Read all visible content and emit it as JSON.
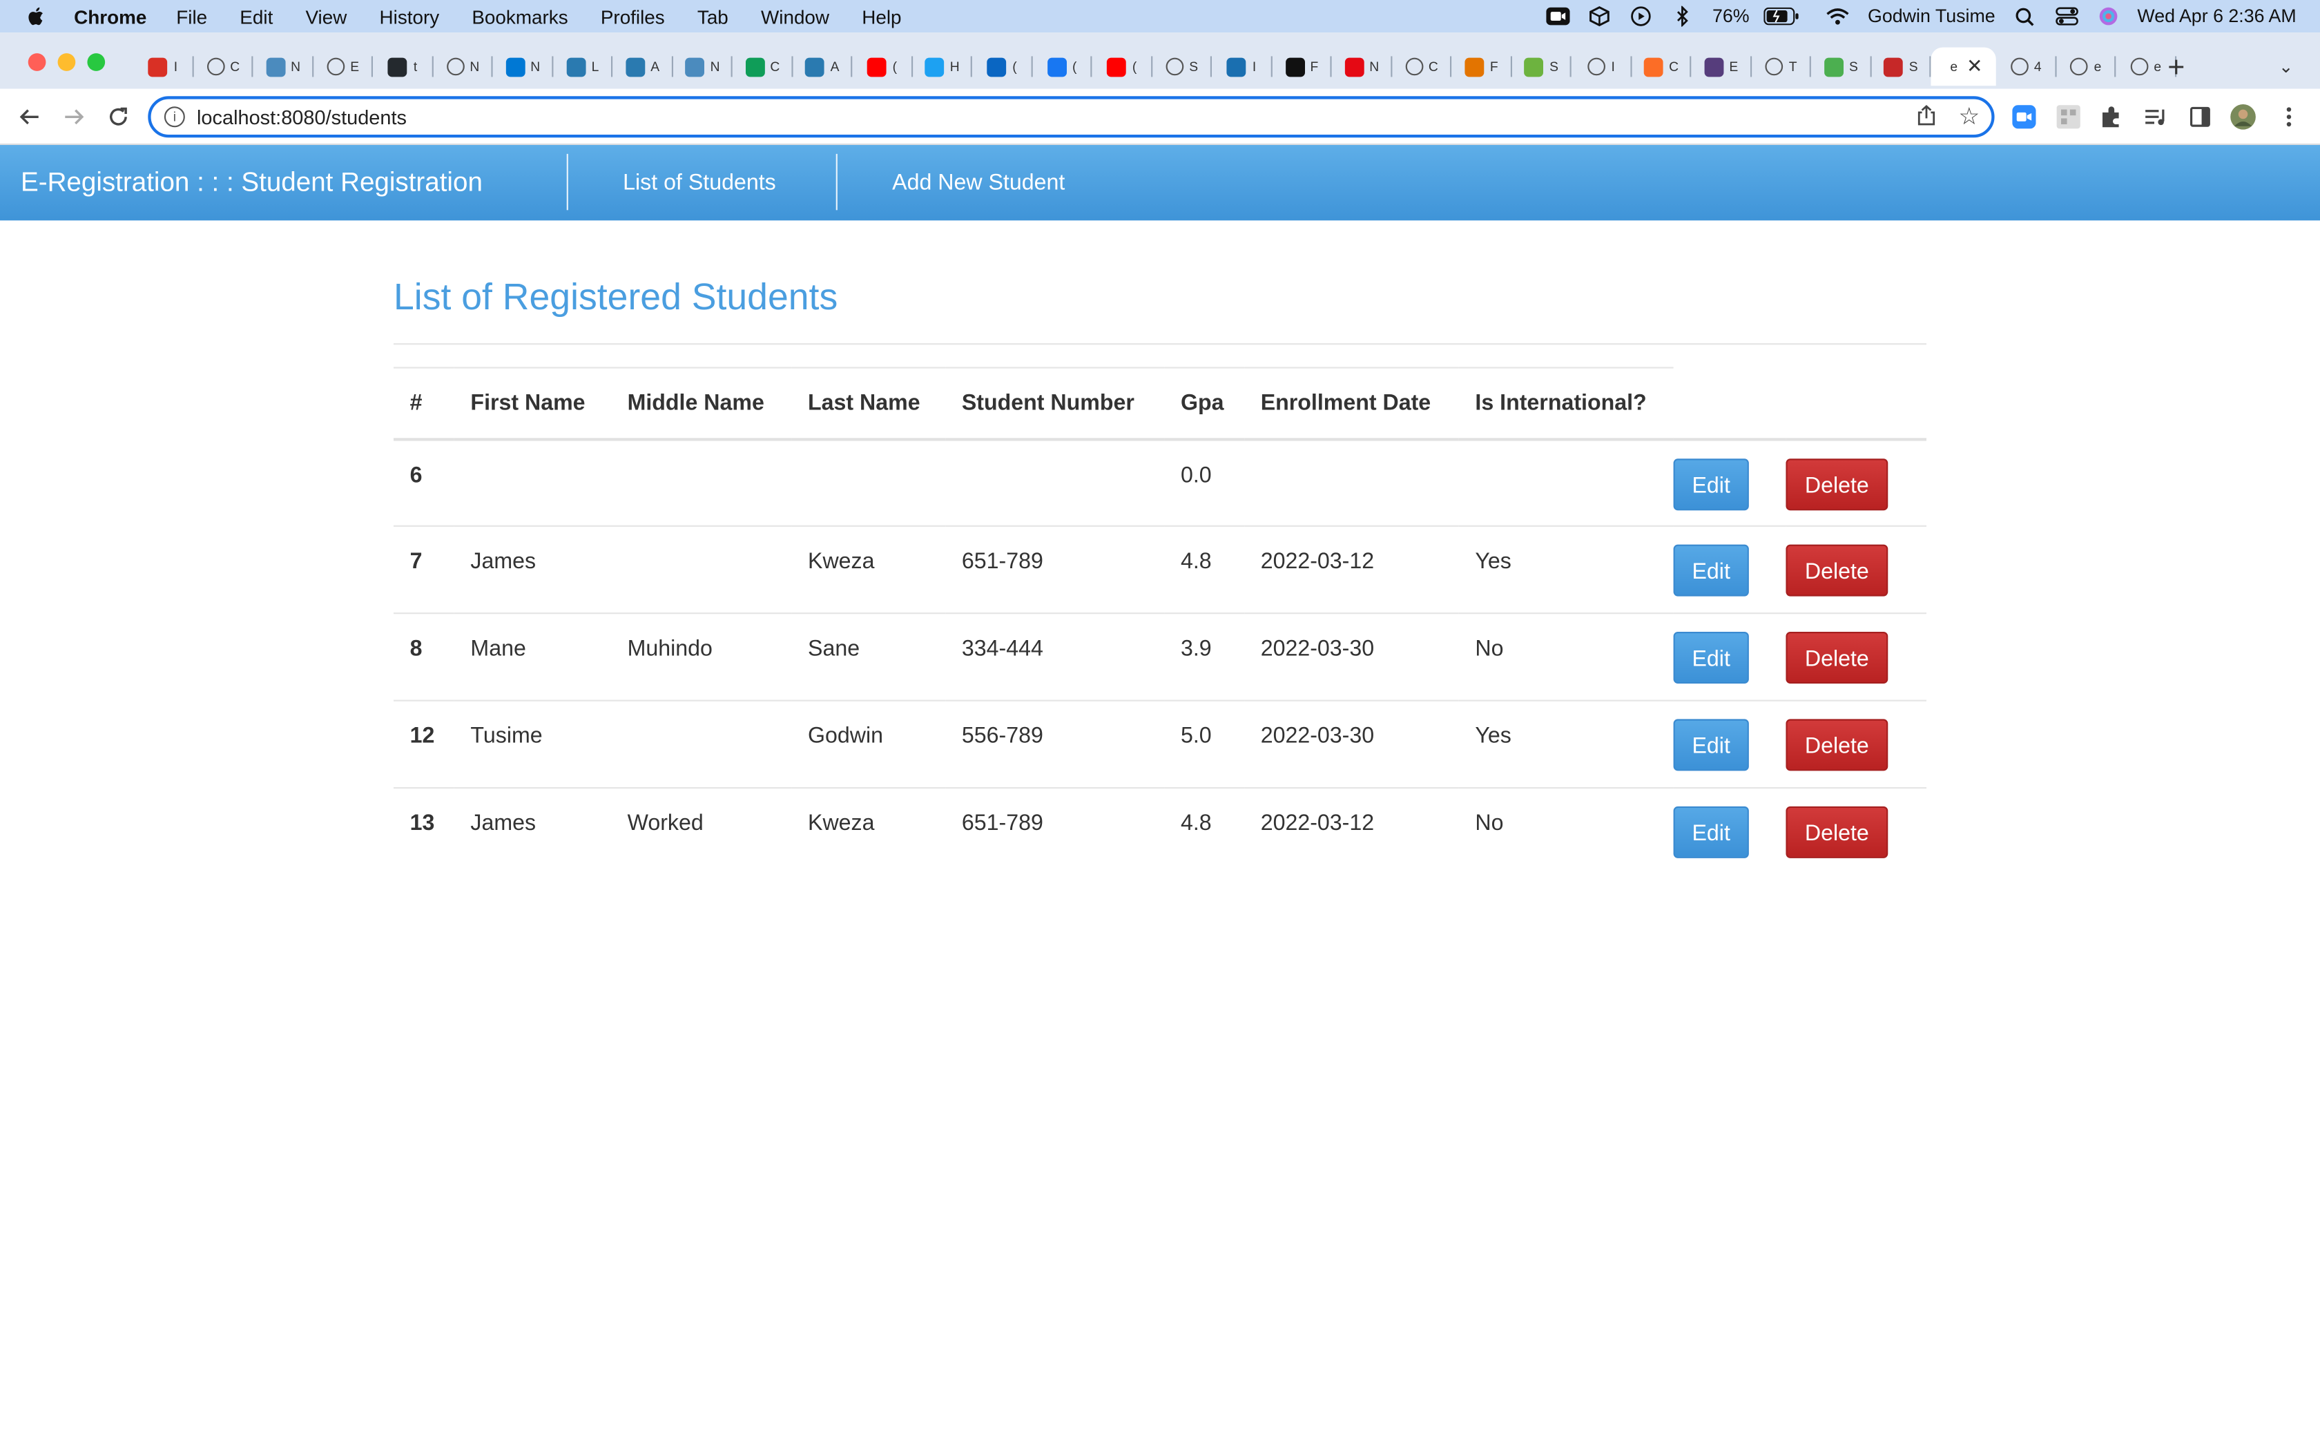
{
  "menubar": {
    "app": "Chrome",
    "items": [
      "File",
      "Edit",
      "View",
      "History",
      "Bookmarks",
      "Profiles",
      "Tab",
      "Window",
      "Help"
    ],
    "battery": "76%",
    "user": "Godwin Tusime",
    "clock": "Wed Apr 6  2:36 AM"
  },
  "tabs": [
    {
      "icon": "gmail-icon",
      "color": "#d93025",
      "text": "I"
    },
    {
      "icon": "globe-icon",
      "color": "#555555",
      "text": "C"
    },
    {
      "icon": "java-icon",
      "color": "#4b8bbe",
      "text": "N"
    },
    {
      "icon": "globe-icon",
      "color": "#555555",
      "text": "E"
    },
    {
      "icon": "github-icon",
      "color": "#24292e",
      "text": "t"
    },
    {
      "icon": "globe-icon",
      "color": "#555555",
      "text": "N"
    },
    {
      "icon": "outlook-icon",
      "color": "#0078d4",
      "text": "N"
    },
    {
      "icon": "doc-icon",
      "color": "#2a7ab0",
      "text": "L"
    },
    {
      "icon": "doc-icon",
      "color": "#2a7ab0",
      "text": "A"
    },
    {
      "icon": "java-icon",
      "color": "#4b8bbe",
      "text": "N"
    },
    {
      "icon": "sheets-icon",
      "color": "#0f9d58",
      "text": "C"
    },
    {
      "icon": "doc-icon",
      "color": "#2a7ab0",
      "text": "A"
    },
    {
      "icon": "youtube-icon",
      "color": "#ff0000",
      "text": "("
    },
    {
      "icon": "twitter-icon",
      "color": "#1da1f2",
      "text": "H"
    },
    {
      "icon": "linkedin-icon",
      "color": "#0a66c2",
      "text": "("
    },
    {
      "icon": "facebook-icon",
      "color": "#1877f2",
      "text": "("
    },
    {
      "icon": "youtube-icon",
      "color": "#ff0000",
      "text": "("
    },
    {
      "icon": "globe-icon",
      "color": "#555555",
      "text": "S"
    },
    {
      "icon": "video-icon",
      "color": "#1a6fb0",
      "text": "I"
    },
    {
      "icon": "p-icon",
      "color": "#111111",
      "text": "F"
    },
    {
      "icon": "netflix-icon",
      "color": "#e50914",
      "text": "N"
    },
    {
      "icon": "globe-icon",
      "color": "#555555",
      "text": "C"
    },
    {
      "icon": "g-icon",
      "color": "#e37400",
      "text": "F"
    },
    {
      "icon": "spring-icon",
      "color": "#6db33f",
      "text": "S"
    },
    {
      "icon": "globe-icon",
      "color": "#555555",
      "text": "I"
    },
    {
      "icon": "gitlab-icon",
      "color": "#fc6d26",
      "text": "C"
    },
    {
      "icon": "bootstrap-icon",
      "color": "#563d7c",
      "text": "E"
    },
    {
      "icon": "globe-icon",
      "color": "#555555",
      "text": "T"
    },
    {
      "icon": "leaf-icon",
      "color": "#4caf50",
      "text": "S"
    },
    {
      "icon": "red-icon",
      "color": "#c62828",
      "text": "S"
    },
    {
      "icon": "active",
      "color": "#ffffff",
      "text": "e"
    },
    {
      "icon": "globe-icon",
      "color": "#555555",
      "text": "4"
    },
    {
      "icon": "globe-icon",
      "color": "#555555",
      "text": "e"
    },
    {
      "icon": "globe-icon",
      "color": "#555555",
      "text": "e"
    }
  ],
  "toolbar": {
    "url": "localhost:8080/students"
  },
  "appnav": {
    "brand": "E-Registration : : : Student Registration",
    "link_list": "List of Students",
    "link_add": "Add New Student"
  },
  "page": {
    "title": "List of Registered Students"
  },
  "table": {
    "headers": [
      "#",
      "First Name",
      "Middle Name",
      "Last Name",
      "Student Number",
      "Gpa",
      "Enrollment Date",
      "Is International?"
    ],
    "rows": [
      [
        "6",
        "",
        "",
        "",
        "",
        "0.0",
        "",
        ""
      ],
      [
        "7",
        "James",
        "",
        "Kweza",
        "651-789",
        "4.8",
        "2022-03-12",
        "Yes"
      ],
      [
        "8",
        "Mane",
        "Muhindo",
        "Sane",
        "334-444",
        "3.9",
        "2022-03-30",
        "No"
      ],
      [
        "12",
        "Tusime",
        "",
        "Godwin",
        "556-789",
        "5.0",
        "2022-03-30",
        "Yes"
      ],
      [
        "13",
        "James",
        "Worked",
        "Kweza",
        "651-789",
        "4.8",
        "2022-03-12",
        "No"
      ]
    ],
    "edit_label": "Edit",
    "delete_label": "Delete"
  },
  "colors": {
    "navbar": "#4a9fdf",
    "title": "#4a9ee0",
    "edit": "#4a9ee0",
    "delete": "#c62c2c"
  }
}
